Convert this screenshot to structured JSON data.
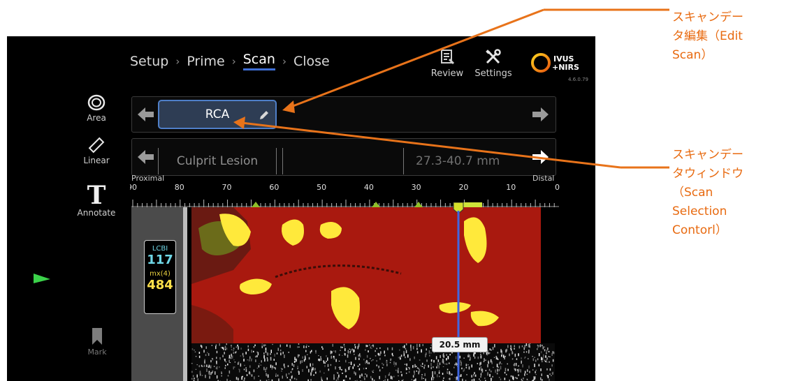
{
  "breadcrumb": [
    {
      "label": "Setup"
    },
    {
      "label": "Prime"
    },
    {
      "label": "Scan",
      "active": true
    },
    {
      "label": "Close"
    }
  ],
  "header": {
    "review_label": "Review",
    "settings_label": "Settings",
    "logo_top": "IVUS",
    "logo_bottom": "+NIRS",
    "version": "4.6.0.79"
  },
  "tools": {
    "area_label": "Area",
    "linear_label": "Linear",
    "annotate_glyph": "T",
    "annotate_label": "Annotate",
    "mark_label": "Mark"
  },
  "scan_selector": {
    "current_scan": "RCA"
  },
  "lesion_selector": {
    "name": "Culprit Lesion",
    "range": "27.3-40.7 mm"
  },
  "axis": {
    "left_label": "Proximal",
    "right_label": "Distal",
    "ticks": [
      "90",
      "80",
      "70",
      "60",
      "50",
      "40",
      "30",
      "20",
      "10",
      "0"
    ]
  },
  "lcbi": {
    "label": "LCBI",
    "value": "117",
    "max_label": "mx(4)",
    "max_value": "484"
  },
  "position_marker": "20.5 mm",
  "callouts": {
    "edit_scan": [
      "スキャンデー",
      "タ編集（Edit",
      "Scan）"
    ],
    "scan_window": [
      "スキャンデー",
      "タウィンドウ",
      "（Scan",
      "Selection",
      "Contorl）"
    ]
  },
  "colors": {
    "accent": "#e8731a",
    "heatmap_bg": "#aa1b14",
    "heatmap_hot": "#ffe93b",
    "selection_blue": "#4f7fc8"
  }
}
